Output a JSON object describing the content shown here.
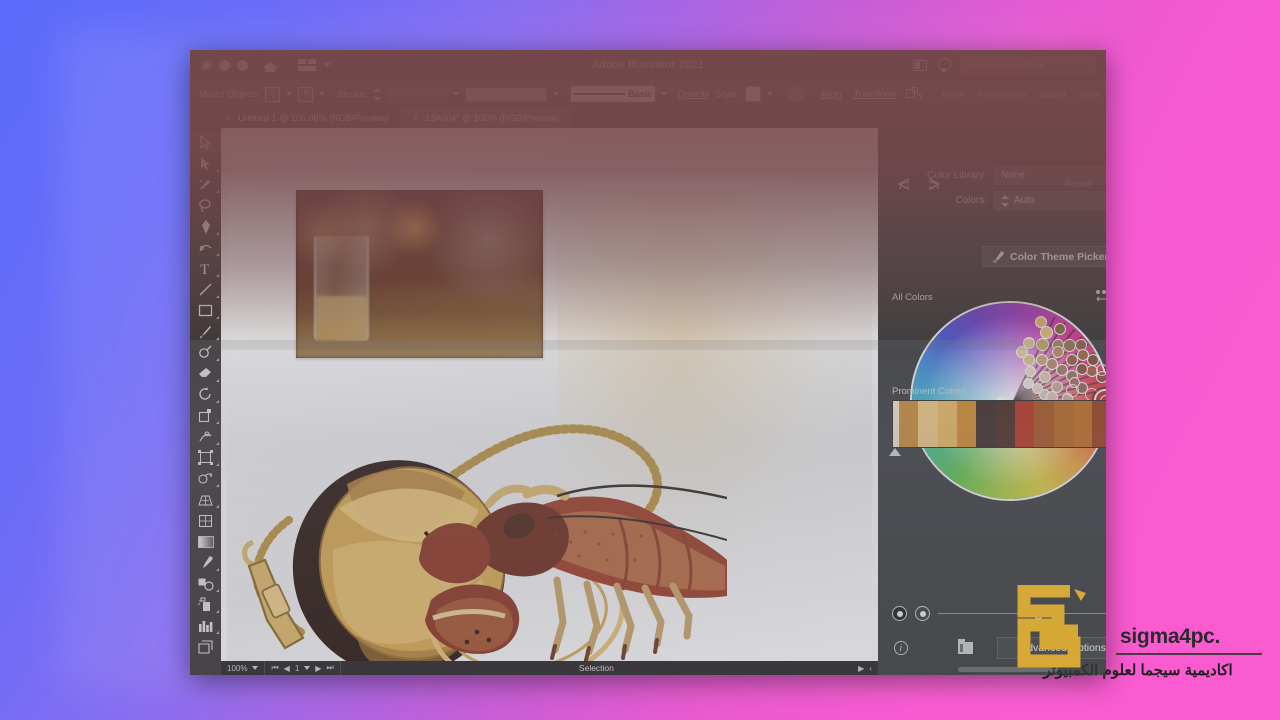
{
  "window": {
    "app_title": "Adobe Illustrator 2021",
    "search_placeholder": "Search Adobe Stock",
    "traffic_lights": [
      "close",
      "minimize",
      "zoom"
    ],
    "home_icon": "home-icon",
    "arrange_icon": "arrange-documents-icon",
    "screen_mode_icon": "screen-mode-icon",
    "tips_icon": "lightbulb-icon"
  },
  "control_bar": {
    "selection_label": "Mixed Objects",
    "fill_swatch": "?",
    "stroke_swatch": "?",
    "stroke_label": "Stroke:",
    "stroke_weight": "",
    "brush_definition": "",
    "graphic_style_label": "Basic",
    "opacity_label": "Opacity",
    "style_label": "Style:",
    "align_label": "Align",
    "transform_label": "Transform",
    "extra_items": [
      "Reset",
      "Preferences",
      "Export",
      "More"
    ]
  },
  "tabs": [
    {
      "title": "Untitled-1 @ 105.08% (RGB/Preview)",
      "active": false,
      "close": "×"
    },
    {
      "title": "13A004* @ 100% (RGB/Preview)",
      "active": true,
      "close": "×"
    }
  ],
  "toolbar": {
    "tools": [
      {
        "name": "selection-tool",
        "selected": true,
        "flyout": false
      },
      {
        "name": "direct-selection-tool",
        "selected": false,
        "flyout": true
      },
      {
        "name": "magic-wand-tool",
        "selected": false,
        "flyout": true
      },
      {
        "name": "lasso-tool",
        "selected": false,
        "flyout": false
      },
      {
        "name": "pen-tool",
        "selected": false,
        "flyout": true
      },
      {
        "name": "curvature-tool",
        "selected": false,
        "flyout": false
      },
      {
        "name": "type-tool",
        "selected": false,
        "flyout": true
      },
      {
        "name": "line-segment-tool",
        "selected": false,
        "flyout": true
      },
      {
        "name": "rectangle-tool",
        "selected": false,
        "flyout": true
      },
      {
        "name": "paintbrush-tool",
        "selected": false,
        "flyout": true
      },
      {
        "name": "shaper-tool",
        "selected": false,
        "flyout": true
      },
      {
        "name": "eraser-tool",
        "selected": false,
        "flyout": true
      },
      {
        "name": "rotate-tool",
        "selected": false,
        "flyout": true
      },
      {
        "name": "scale-tool",
        "selected": false,
        "flyout": true
      },
      {
        "name": "width-tool",
        "selected": false,
        "flyout": true
      },
      {
        "name": "free-transform-tool",
        "selected": false,
        "flyout": true
      },
      {
        "name": "shape-builder-tool",
        "selected": false,
        "flyout": true
      },
      {
        "name": "perspective-grid-tool",
        "selected": false,
        "flyout": true
      },
      {
        "name": "mesh-tool",
        "selected": false,
        "flyout": false
      },
      {
        "name": "gradient-tool",
        "selected": false,
        "flyout": false
      },
      {
        "name": "eyedropper-tool",
        "selected": false,
        "flyout": true
      },
      {
        "name": "blend-tool",
        "selected": false,
        "flyout": true
      },
      {
        "name": "symbol-sprayer-tool",
        "selected": false,
        "flyout": true
      },
      {
        "name": "column-graph-tool",
        "selected": false,
        "flyout": true
      },
      {
        "name": "artboard-tool",
        "selected": false,
        "flyout": false
      }
    ]
  },
  "canvas": {
    "photo_alt": "blurred bar interior with beer glass",
    "artwork_alt": "lobster with pocket watch illustration"
  },
  "status_bar": {
    "zoom_level": "100%",
    "page_number": "1",
    "status_text": "Selection",
    "first_page_icon": "first-page-icon",
    "prev_page_icon": "prev-page-icon",
    "next_page_icon": "next-page-icon",
    "last_page_icon": "last-page-icon"
  },
  "color_panel": {
    "undo_icon": "undo-icon",
    "redo_icon": "redo-icon",
    "reset_label": "Reset",
    "color_library_label": "Color Library:",
    "color_library_value": "None",
    "colors_label": "Colors:",
    "colors_value": "Auto",
    "color_theme_picker_label": "Color Theme Picker",
    "color_theme_picker_icon": "eyedropper-icon",
    "all_colors_label": "All Colors",
    "wheel_icon_1": "unlink-harmony-icon",
    "wheel_icon_2": "show-hide-icon",
    "link_icon": "link-colors-icon",
    "prominent_colors_label": "Prominent Colors",
    "prominent_colors": [
      "#f0e2cb",
      "#c98a33",
      "#efc77e",
      "#e8b85d",
      "#d28b28",
      "#3a2a22",
      "#4a2a1e",
      "#b8311b",
      "#a8521c",
      "#b5651d",
      "#c06a1c",
      "#9a3c15",
      "#8f3314"
    ],
    "view_mode_1": "color-wheel-view",
    "view_mode_2": "color-bar-view",
    "slider_value": 50,
    "info_icon": "info-icon",
    "save_icon": "save-theme-icon",
    "advanced_options_label": "Advanced Options...",
    "wheel_selected_color": "#b8322a",
    "wheel_swatches": [
      {
        "angle": 64,
        "radius": 0.78,
        "size": 13,
        "color": "#e0c078"
      },
      {
        "angle": 70,
        "radius": 0.86,
        "size": 12,
        "color": "#d9b86a"
      },
      {
        "angle": 57,
        "radius": 0.88,
        "size": 12,
        "color": "#8a6a4a"
      },
      {
        "angle": 74,
        "radius": 0.62,
        "size": 12,
        "color": "#e6cb8c"
      },
      {
        "angle": 62,
        "radius": 0.66,
        "size": 13,
        "color": "#cfa95e"
      },
      {
        "angle": 52,
        "radius": 0.74,
        "size": 12,
        "color": "#b08050"
      },
      {
        "angle": 45,
        "radius": 0.82,
        "size": 13,
        "color": "#a07048"
      },
      {
        "angle": 40,
        "radius": 0.9,
        "size": 12,
        "color": "#8d5a3c"
      },
      {
        "angle": 34,
        "radius": 0.86,
        "size": 12,
        "color": "#9a6248"
      },
      {
        "angle": 28,
        "radius": 0.92,
        "size": 12,
        "color": "#7d4a34"
      },
      {
        "angle": 22,
        "radius": 0.86,
        "size": 12,
        "color": "#a35a42"
      },
      {
        "angle": 16,
        "radius": 0.94,
        "size": 12,
        "color": "#8e4a36"
      },
      {
        "angle": 79,
        "radius": 0.52,
        "size": 12,
        "color": "#e4c98f"
      },
      {
        "angle": 68,
        "radius": 0.46,
        "size": 12,
        "color": "#d9bd84"
      },
      {
        "angle": 55,
        "radius": 0.52,
        "size": 12,
        "color": "#c2a277"
      },
      {
        "angle": 44,
        "radius": 0.56,
        "size": 12,
        "color": "#b08a6b"
      },
      {
        "angle": 33,
        "radius": 0.6,
        "size": 12,
        "color": "#a3785e"
      },
      {
        "angle": 24,
        "radius": 0.66,
        "size": 12,
        "color": "#97705a"
      },
      {
        "angle": 12,
        "radius": 0.72,
        "size": 12,
        "color": "#8e6356"
      },
      {
        "angle": 5,
        "radius": 0.56,
        "size": 11,
        "color": "#c9a79c"
      },
      {
        "angle": 14,
        "radius": 0.34,
        "size": 11,
        "color": "#d8c0b4"
      },
      {
        "angle": 30,
        "radius": 0.3,
        "size": 11,
        "color": "#e0cfc2"
      },
      {
        "angle": 50,
        "radius": 0.26,
        "size": 11,
        "color": "#ece0d4"
      },
      {
        "angle": 178,
        "radius": 0.1,
        "size": 14,
        "color": "#fdfdfd"
      },
      {
        "angle": 300,
        "radius": 0.24,
        "size": 13,
        "color": "#ecc8dd"
      },
      {
        "angle": 8,
        "radius": 0.4,
        "size": 12,
        "color": "#d9bfb4"
      },
      {
        "angle": 20,
        "radius": 0.48,
        "size": 12,
        "color": "#c8a593"
      },
      {
        "angle": 38,
        "radius": 0.42,
        "size": 12,
        "color": "#dcc0ab"
      },
      {
        "angle": 60,
        "radius": 0.36,
        "size": 11,
        "color": "#e6d2b8"
      },
      {
        "angle": 26,
        "radius": 0.78,
        "size": 12,
        "color": "#86503c"
      },
      {
        "angle": 36,
        "radius": 0.74,
        "size": 12,
        "color": "#945c40"
      },
      {
        "angle": 48,
        "radius": 0.68,
        "size": 12,
        "color": "#b98a58"
      },
      {
        "angle": 18,
        "radius": 0.66,
        "size": 11,
        "color": "#a66a58"
      }
    ],
    "wheel_rings": [
      {
        "angle": 12,
        "radius": 0.62,
        "size": 13
      },
      {
        "angle": 6,
        "radius": 0.8,
        "size": 13
      },
      {
        "angle": 20,
        "radius": 0.96,
        "size": 12
      }
    ],
    "spokes": [
      64,
      57,
      50,
      44,
      38,
      32,
      26,
      20,
      14,
      8,
      2
    ]
  },
  "dock": {
    "column_left": [
      {
        "name": "properties-panel-icon"
      },
      {
        "name": "libraries-panel-icon"
      },
      {
        "name": "export-panel-icon"
      }
    ],
    "column_mid": [
      {
        "name": "adjust-panel-icon"
      },
      {
        "name": "layers-compose-icon"
      },
      {
        "name": "asset-export-icon"
      }
    ],
    "column_right": [
      {
        "name": "swatches-panel-icon"
      },
      {
        "name": "color-guide-panel-icon"
      },
      {
        "name": "gradient-panel-icon"
      },
      {
        "name": "layers-panel-icon"
      },
      {
        "name": "character-panel-icon"
      },
      {
        "name": "glyphs-panel-icon"
      },
      {
        "name": "paragraph-panel-icon"
      },
      {
        "name": "align-panel-icon"
      },
      {
        "name": "transparency-panel-icon"
      },
      {
        "name": "appearance-panel-icon"
      },
      {
        "name": "artboards-panel-icon"
      },
      {
        "name": "transform-panel-icon"
      },
      {
        "name": "pathfinder-panel-icon"
      },
      {
        "name": "brushes-panel-icon"
      },
      {
        "name": "symbols-panel-icon"
      },
      {
        "name": "graphic-styles-panel-icon"
      }
    ]
  },
  "watermark": {
    "brand": "sigma4pc",
    "brand_suffix": ".",
    "arabic_tagline": "اكاديمية سيجما لعلوم الكمبيوتر",
    "logo_color": "#f5b71d"
  }
}
